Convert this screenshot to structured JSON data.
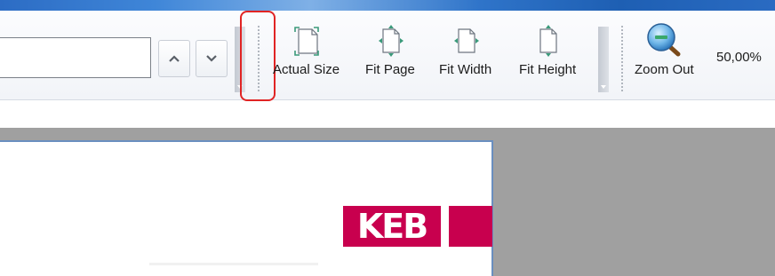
{
  "window": {
    "titlebar_color": "#2f74c9"
  },
  "toolbar": {
    "search_input_value": "",
    "prev_button_icon": "chevron-up-icon",
    "next_button_icon": "chevron-down-icon",
    "tools": [
      {
        "label": "Actual Size",
        "icon": "actual-size-icon"
      },
      {
        "label": "Fit Page",
        "icon": "fit-page-icon"
      },
      {
        "label": "Fit Width",
        "icon": "fit-width-icon"
      },
      {
        "label": "Fit Height",
        "icon": "fit-height-icon"
      },
      {
        "label": "Zoom Out",
        "icon": "zoom-out-icon"
      }
    ],
    "zoom_value": "50,00%",
    "accent_green": "#3a9a7a",
    "highlight_color": "#e02424"
  },
  "document": {
    "logo_text": "KEB",
    "logo_color": "#c8004e",
    "workspace_color": "#a0a0a0"
  }
}
